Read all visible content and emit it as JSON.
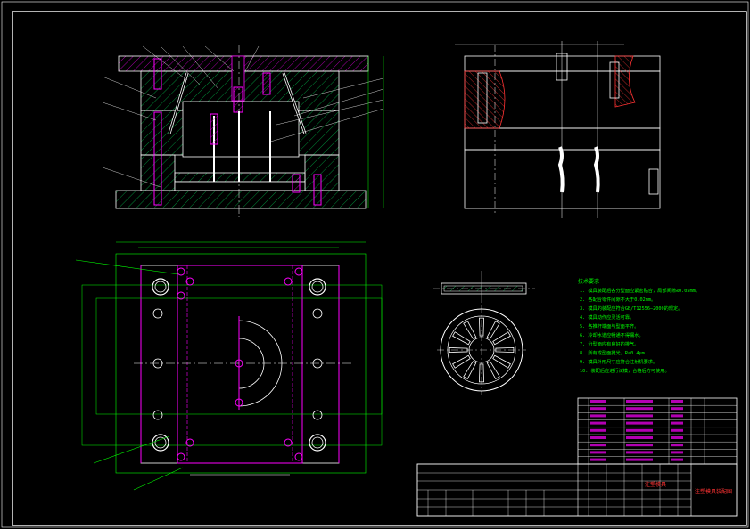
{
  "colors": {
    "background": "#000000",
    "frame": "#ffffff",
    "outline": "#ffffff",
    "hatch_green": "#00aa44",
    "bright_green": "#00ff00",
    "magenta": "#ff00ff",
    "red": "#ff3333",
    "yellow": "#ffff00"
  },
  "tech_requirements": {
    "heading": "技术要求",
    "items": [
      "1. 模具装配后各分型面应紧密贴合，局部间隙≤0.05mm。",
      "2. 各配合零件间隙不大于0.02mm。",
      "3. 模具的装配应符合GB/T12556—2000的规定。",
      "4. 模具动作应灵活可靠。",
      "5. 各推杆端面与型面平齐。",
      "6. 冷却水道应畅通不得漏水。",
      "7. 分型面应有良好的排气。",
      "8. 所有成型面抛光，Ra0.4μm",
      "9. 模具外形尺寸应符合注射机要求。",
      "10. 装配后应进行试模，合格后方可使用。"
    ]
  },
  "title_block": {
    "drawing_name": "注塑模具装配图",
    "part_name": "注塑模具"
  }
}
